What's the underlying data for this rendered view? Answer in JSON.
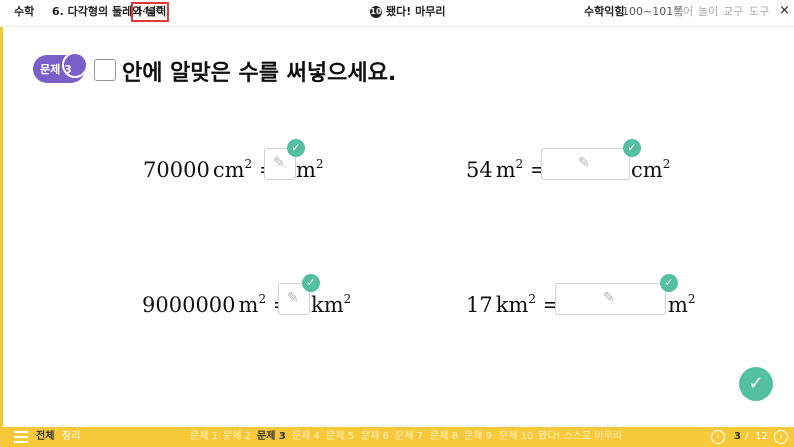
{
  "header": {
    "subject": "수학",
    "chapter": "6. 다각형의 둘레와 넓이",
    "page": "149쪽",
    "center_num": "10",
    "center_title": "됐다! 마무리",
    "right_link": "수학익힘",
    "right_pages": "100~101쪽",
    "tools": [
      "용어",
      "놀이",
      "교구",
      "도구"
    ],
    "close": "×"
  },
  "problem": {
    "badge": "문제 3",
    "instruction": "안에 알맞은 수를 써넣으세요."
  },
  "equations": [
    {
      "value": "70000",
      "from_unit": "cm",
      "to_unit": "m",
      "exp": "2",
      "eq": "="
    },
    {
      "value": "54",
      "from_unit": "m",
      "to_unit": "cm",
      "exp": "2",
      "eq": "="
    },
    {
      "value": "9000000",
      "from_unit": "m",
      "to_unit": "km",
      "exp": "2",
      "eq": "="
    },
    {
      "value": "17",
      "from_unit": "km",
      "to_unit": "m",
      "exp": "2",
      "eq": "="
    }
  ],
  "icons": {
    "pencil": "✎",
    "check": "✓"
  },
  "footer": {
    "all": "전체",
    "summary": "정리",
    "tabs": [
      "문제 1",
      "문제 2",
      "문제 3",
      "문제 4",
      "문제 5",
      "문제 6",
      "문제 7",
      "문제 8",
      "문제 9",
      "문제 10",
      "됐다! 스스로 마무리"
    ],
    "current": "3",
    "separator": "/",
    "total": "12"
  },
  "colors": {
    "accent_yellow": "#f7c93a",
    "badge_purple": "#7a5fc8",
    "check_green": "#54bfa1",
    "highlight_red": "#e23a3a"
  }
}
